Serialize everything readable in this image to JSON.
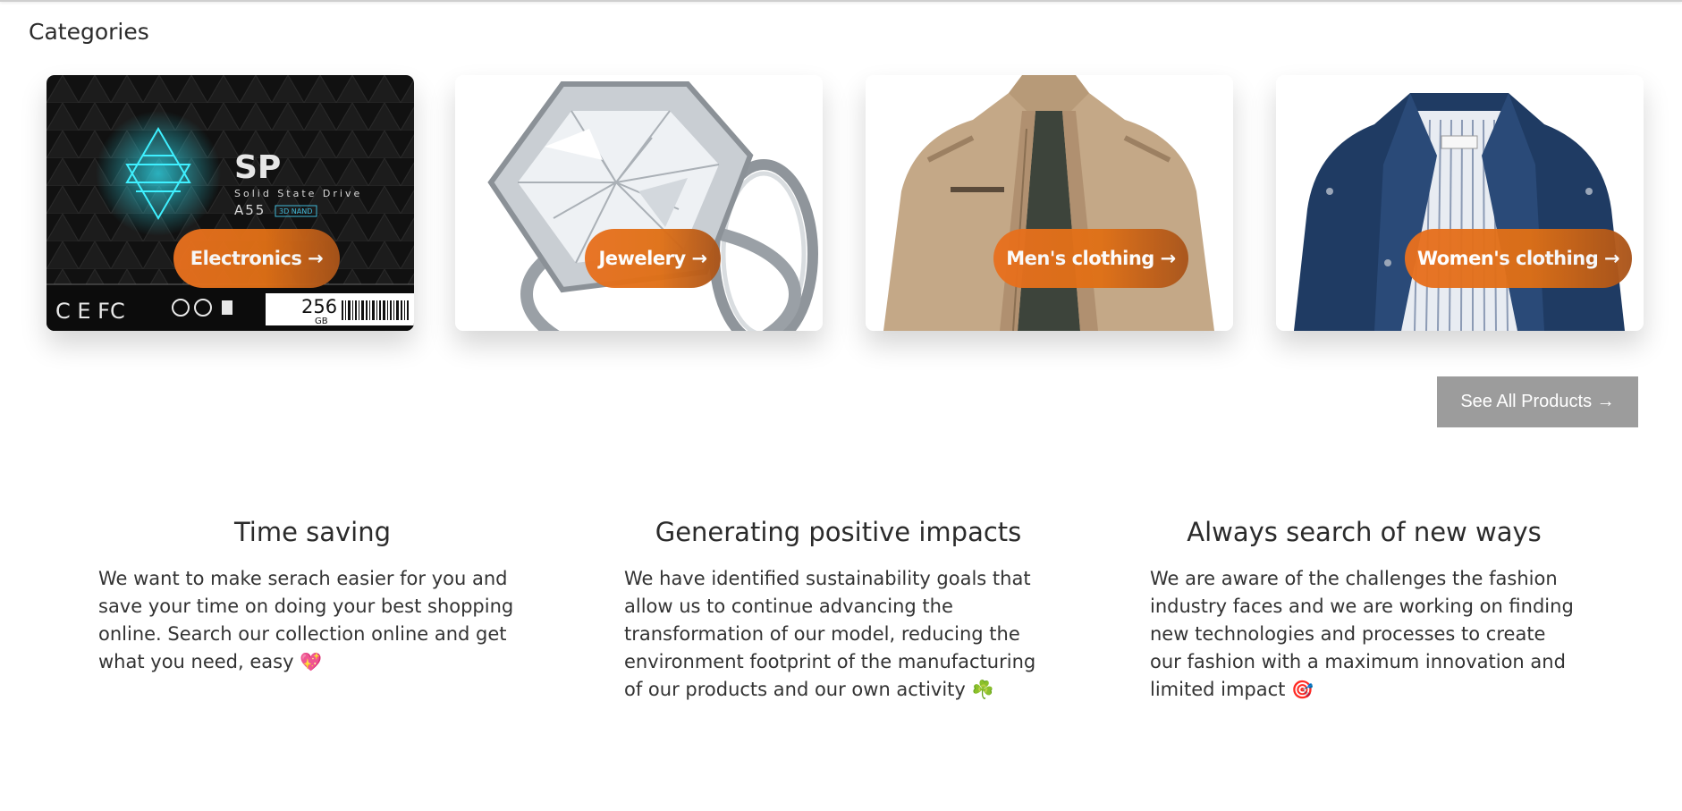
{
  "categories_section": {
    "title": "Categories",
    "items": [
      {
        "label": "Electronics →",
        "image": "ssd-drive-image"
      },
      {
        "label": "Jewelery →",
        "image": "diamond-ring-image"
      },
      {
        "label": "Men's clothing →",
        "image": "mens-jacket-image"
      },
      {
        "label": "Women's clothing →",
        "image": "womens-jacket-image"
      }
    ],
    "ssd_brand": "SP",
    "ssd_line1": "Solid State Drive",
    "ssd_model": "A55",
    "ssd_badge": "3D NAND",
    "ssd_capacity": "256",
    "ssd_unit": "GB"
  },
  "see_all_label": "See All Products →",
  "features": [
    {
      "title": "Time saving",
      "text": "We want to make serach easier for you and save your time on doing your best shopping online. Search our collection online and get what you need, easy",
      "emoji": "💖"
    },
    {
      "title": "Generating positive impacts",
      "text": "We have identified sustainability goals that allow us to continue advancing the transformation of our model, reducing the environment footprint of the manufacturing of our products and our own activity",
      "emoji": "☘️"
    },
    {
      "title": "Always search of new ways",
      "text": "We are aware of the challenges the fashion industry faces and we are working on finding new technologies and processes to create our fashion with a maximum innovation and limited impact",
      "emoji": "🎯"
    }
  ],
  "colors": {
    "accent": "#e8701f",
    "button_gray": "#9c9c9c",
    "text": "#333333"
  }
}
